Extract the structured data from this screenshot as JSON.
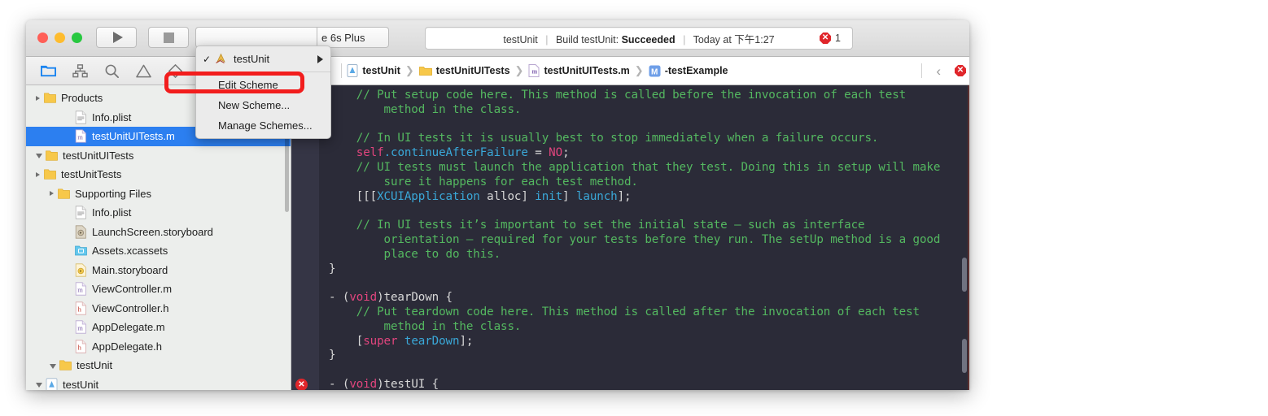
{
  "window": {
    "traffic_lights": [
      "close",
      "minimize",
      "zoom"
    ]
  },
  "toolbar": {
    "run_label": "Run",
    "stop_label": "Stop",
    "scheme_name": "testUnit",
    "device_name": "e 6s Plus",
    "status": {
      "project": "testUnit",
      "build_text": "Build testUnit:",
      "build_result": "Succeeded",
      "timestamp": "Today at 下午1:27",
      "error_count": "1"
    }
  },
  "navigator_toolbar": {
    "icons": [
      {
        "name": "folder-icon",
        "label": "Project Navigator",
        "active": true
      },
      {
        "name": "hierarchy-icon",
        "label": "Symbol Navigator",
        "active": false
      },
      {
        "name": "search-icon",
        "label": "Find Navigator",
        "active": false
      },
      {
        "name": "warning-triangle-icon",
        "label": "Issue Navigator",
        "active": false
      },
      {
        "name": "test-diamond-icon",
        "label": "Test Navigator",
        "active": false
      }
    ]
  },
  "breadcrumb": {
    "back_label": "‹",
    "forward_label": "›",
    "items": [
      {
        "label": "testUnit",
        "icon": "project-icon"
      },
      {
        "label": "testUnitUITests",
        "icon": "folder-icon"
      },
      {
        "label": "testUnitUITests.m",
        "icon": "m-file-icon"
      },
      {
        "label": "-testExample",
        "icon": "method-icon"
      }
    ],
    "right_back_label": "‹"
  },
  "scheme_menu": {
    "items": [
      {
        "label": "testUnit",
        "checked": true,
        "icon": "xcode-scheme-icon",
        "has_submenu": true
      },
      {
        "label": "Edit Scheme",
        "checked": false,
        "indent": true
      },
      {
        "label": "New Scheme...",
        "checked": false,
        "indent": true,
        "highlighted": true
      },
      {
        "label": "Manage Schemes...",
        "checked": false,
        "indent": true
      }
    ]
  },
  "navigator": {
    "rows": [
      {
        "label": "testUnit",
        "indent": 0,
        "disclosure": "open",
        "icon": "project-icon",
        "selected": false
      },
      {
        "label": "testUnit",
        "indent": 1,
        "disclosure": "open",
        "icon": "folder-icon",
        "selected": false
      },
      {
        "label": "AppDelegate.h",
        "indent": 2,
        "disclosure": "none",
        "icon": "h-file-icon",
        "selected": false
      },
      {
        "label": "AppDelegate.m",
        "indent": 2,
        "disclosure": "none",
        "icon": "m-file-icon",
        "selected": false
      },
      {
        "label": "ViewController.h",
        "indent": 2,
        "disclosure": "none",
        "icon": "h-file-icon",
        "selected": false
      },
      {
        "label": "ViewController.m",
        "indent": 2,
        "disclosure": "none",
        "icon": "m-file-icon",
        "selected": false
      },
      {
        "label": "Main.storyboard",
        "indent": 2,
        "disclosure": "none",
        "icon": "storyboard-icon",
        "selected": false
      },
      {
        "label": "Assets.xcassets",
        "indent": 2,
        "disclosure": "none",
        "icon": "assets-icon",
        "selected": false
      },
      {
        "label": "LaunchScreen.storyboard",
        "indent": 2,
        "disclosure": "none",
        "icon": "storyboard-gray-icon",
        "selected": false
      },
      {
        "label": "Info.plist",
        "indent": 2,
        "disclosure": "none",
        "icon": "plist-icon",
        "selected": false
      },
      {
        "label": "Supporting Files",
        "indent": 1,
        "disclosure": "closed",
        "icon": "folder-icon",
        "selected": false
      },
      {
        "label": "testUnitTests",
        "indent": 0,
        "disclosure": "closed",
        "icon": "folder-icon",
        "selected": false
      },
      {
        "label": "testUnitUITests",
        "indent": 0,
        "disclosure": "open",
        "icon": "folder-icon",
        "selected": false
      },
      {
        "label": "testUnitUITests.m",
        "indent": 2,
        "disclosure": "none",
        "icon": "m-file-icon",
        "selected": true
      },
      {
        "label": "Info.plist",
        "indent": 2,
        "disclosure": "none",
        "icon": "plist-icon",
        "selected": false
      },
      {
        "label": "Products",
        "indent": 0,
        "disclosure": "closed",
        "icon": "folder-icon",
        "selected": false
      }
    ]
  },
  "editor": {
    "error_marker": "✕",
    "lines": [
      [
        {
          "t": "    ",
          "c": "pl"
        },
        {
          "t": "// Put setup code here. This method is called before the invocation of each test",
          "c": "cm"
        }
      ],
      [
        {
          "t": "        method in the class.",
          "c": "cm"
        }
      ],
      [
        {
          "t": "",
          "c": "pl"
        }
      ],
      [
        {
          "t": "    ",
          "c": "pl"
        },
        {
          "t": "// In UI tests it is usually best to stop immediately when a failure occurs.",
          "c": "cm"
        }
      ],
      [
        {
          "t": "    ",
          "c": "pl"
        },
        {
          "t": "self",
          "c": "kw"
        },
        {
          "t": ".continueAfterFailure",
          "c": "ty"
        },
        {
          "t": " = ",
          "c": "pl"
        },
        {
          "t": "NO",
          "c": "kw"
        },
        {
          "t": ";",
          "c": "pl"
        }
      ],
      [
        {
          "t": "    ",
          "c": "pl"
        },
        {
          "t": "// UI tests must launch the application that they test. Doing this in setup will make",
          "c": "cm"
        }
      ],
      [
        {
          "t": "        sure it happens for each test method.",
          "c": "cm"
        }
      ],
      [
        {
          "t": "    [[[",
          "c": "pl"
        },
        {
          "t": "XCUIApplication",
          "c": "ty"
        },
        {
          "t": " alloc] ",
          "c": "pl"
        },
        {
          "t": "init",
          "c": "ty"
        },
        {
          "t": "] ",
          "c": "pl"
        },
        {
          "t": "launch",
          "c": "ty"
        },
        {
          "t": "];",
          "c": "pl"
        }
      ],
      [
        {
          "t": "",
          "c": "pl"
        }
      ],
      [
        {
          "t": "    ",
          "c": "pl"
        },
        {
          "t": "// In UI tests it’s important to set the initial state — such as interface",
          "c": "cm"
        }
      ],
      [
        {
          "t": "        orientation — required for your tests before they run. The setUp method is a good",
          "c": "cm"
        }
      ],
      [
        {
          "t": "        place to do this.",
          "c": "cm"
        }
      ],
      [
        {
          "t": "}",
          "c": "pl"
        }
      ],
      [
        {
          "t": "",
          "c": "pl"
        }
      ],
      [
        {
          "t": "- (",
          "c": "pl"
        },
        {
          "t": "void",
          "c": "kw"
        },
        {
          "t": ")tearDown {",
          "c": "pl"
        }
      ],
      [
        {
          "t": "    ",
          "c": "pl"
        },
        {
          "t": "// Put teardown code here. This method is called after the invocation of each test",
          "c": "cm"
        }
      ],
      [
        {
          "t": "        method in the class.",
          "c": "cm"
        }
      ],
      [
        {
          "t": "    [",
          "c": "pl"
        },
        {
          "t": "super",
          "c": "kw"
        },
        {
          "t": " ",
          "c": "pl"
        },
        {
          "t": "tearDown",
          "c": "ty"
        },
        {
          "t": "];",
          "c": "pl"
        }
      ],
      [
        {
          "t": "}",
          "c": "pl"
        }
      ],
      [
        {
          "t": "",
          "c": "pl"
        }
      ],
      [
        {
          "t": "- (",
          "c": "pl"
        },
        {
          "t": "void",
          "c": "kw"
        },
        {
          "t": ")testUI {",
          "c": "pl"
        }
      ]
    ]
  },
  "colors": {
    "selection_blue": "#2c7ff0",
    "editor_bg": "#2b2b38",
    "comment_green": "#54b860",
    "keyword_pink": "#e2457e",
    "type_cyan": "#3aa8d8",
    "error_red": "#e0262b",
    "annotation_red": "#f21d1d"
  }
}
